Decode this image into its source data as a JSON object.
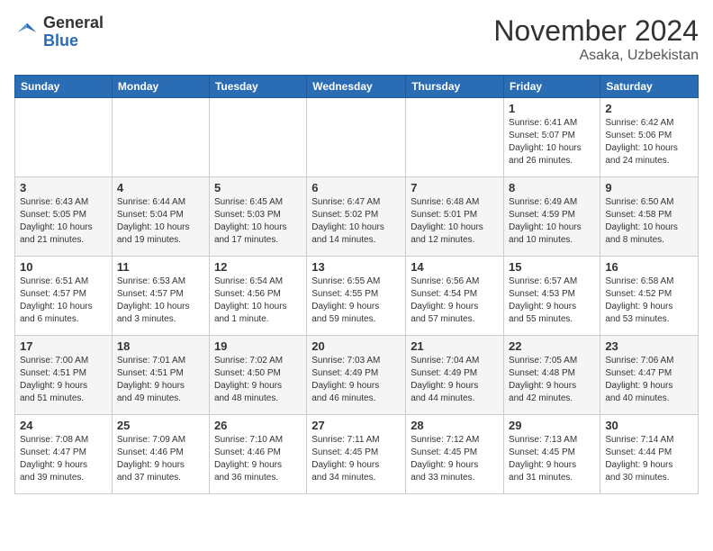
{
  "header": {
    "logo_general": "General",
    "logo_blue": "Blue",
    "month_title": "November 2024",
    "location": "Asaka, Uzbekistan"
  },
  "weekdays": [
    "Sunday",
    "Monday",
    "Tuesday",
    "Wednesday",
    "Thursday",
    "Friday",
    "Saturday"
  ],
  "weeks": [
    [
      {
        "day": "",
        "info": ""
      },
      {
        "day": "",
        "info": ""
      },
      {
        "day": "",
        "info": ""
      },
      {
        "day": "",
        "info": ""
      },
      {
        "day": "",
        "info": ""
      },
      {
        "day": "1",
        "info": "Sunrise: 6:41 AM\nSunset: 5:07 PM\nDaylight: 10 hours\nand 26 minutes."
      },
      {
        "day": "2",
        "info": "Sunrise: 6:42 AM\nSunset: 5:06 PM\nDaylight: 10 hours\nand 24 minutes."
      }
    ],
    [
      {
        "day": "3",
        "info": "Sunrise: 6:43 AM\nSunset: 5:05 PM\nDaylight: 10 hours\nand 21 minutes."
      },
      {
        "day": "4",
        "info": "Sunrise: 6:44 AM\nSunset: 5:04 PM\nDaylight: 10 hours\nand 19 minutes."
      },
      {
        "day": "5",
        "info": "Sunrise: 6:45 AM\nSunset: 5:03 PM\nDaylight: 10 hours\nand 17 minutes."
      },
      {
        "day": "6",
        "info": "Sunrise: 6:47 AM\nSunset: 5:02 PM\nDaylight: 10 hours\nand 14 minutes."
      },
      {
        "day": "7",
        "info": "Sunrise: 6:48 AM\nSunset: 5:01 PM\nDaylight: 10 hours\nand 12 minutes."
      },
      {
        "day": "8",
        "info": "Sunrise: 6:49 AM\nSunset: 4:59 PM\nDaylight: 10 hours\nand 10 minutes."
      },
      {
        "day": "9",
        "info": "Sunrise: 6:50 AM\nSunset: 4:58 PM\nDaylight: 10 hours\nand 8 minutes."
      }
    ],
    [
      {
        "day": "10",
        "info": "Sunrise: 6:51 AM\nSunset: 4:57 PM\nDaylight: 10 hours\nand 6 minutes."
      },
      {
        "day": "11",
        "info": "Sunrise: 6:53 AM\nSunset: 4:57 PM\nDaylight: 10 hours\nand 3 minutes."
      },
      {
        "day": "12",
        "info": "Sunrise: 6:54 AM\nSunset: 4:56 PM\nDaylight: 10 hours\nand 1 minute."
      },
      {
        "day": "13",
        "info": "Sunrise: 6:55 AM\nSunset: 4:55 PM\nDaylight: 9 hours\nand 59 minutes."
      },
      {
        "day": "14",
        "info": "Sunrise: 6:56 AM\nSunset: 4:54 PM\nDaylight: 9 hours\nand 57 minutes."
      },
      {
        "day": "15",
        "info": "Sunrise: 6:57 AM\nSunset: 4:53 PM\nDaylight: 9 hours\nand 55 minutes."
      },
      {
        "day": "16",
        "info": "Sunrise: 6:58 AM\nSunset: 4:52 PM\nDaylight: 9 hours\nand 53 minutes."
      }
    ],
    [
      {
        "day": "17",
        "info": "Sunrise: 7:00 AM\nSunset: 4:51 PM\nDaylight: 9 hours\nand 51 minutes."
      },
      {
        "day": "18",
        "info": "Sunrise: 7:01 AM\nSunset: 4:51 PM\nDaylight: 9 hours\nand 49 minutes."
      },
      {
        "day": "19",
        "info": "Sunrise: 7:02 AM\nSunset: 4:50 PM\nDaylight: 9 hours\nand 48 minutes."
      },
      {
        "day": "20",
        "info": "Sunrise: 7:03 AM\nSunset: 4:49 PM\nDaylight: 9 hours\nand 46 minutes."
      },
      {
        "day": "21",
        "info": "Sunrise: 7:04 AM\nSunset: 4:49 PM\nDaylight: 9 hours\nand 44 minutes."
      },
      {
        "day": "22",
        "info": "Sunrise: 7:05 AM\nSunset: 4:48 PM\nDaylight: 9 hours\nand 42 minutes."
      },
      {
        "day": "23",
        "info": "Sunrise: 7:06 AM\nSunset: 4:47 PM\nDaylight: 9 hours\nand 40 minutes."
      }
    ],
    [
      {
        "day": "24",
        "info": "Sunrise: 7:08 AM\nSunset: 4:47 PM\nDaylight: 9 hours\nand 39 minutes."
      },
      {
        "day": "25",
        "info": "Sunrise: 7:09 AM\nSunset: 4:46 PM\nDaylight: 9 hours\nand 37 minutes."
      },
      {
        "day": "26",
        "info": "Sunrise: 7:10 AM\nSunset: 4:46 PM\nDaylight: 9 hours\nand 36 minutes."
      },
      {
        "day": "27",
        "info": "Sunrise: 7:11 AM\nSunset: 4:45 PM\nDaylight: 9 hours\nand 34 minutes."
      },
      {
        "day": "28",
        "info": "Sunrise: 7:12 AM\nSunset: 4:45 PM\nDaylight: 9 hours\nand 33 minutes."
      },
      {
        "day": "29",
        "info": "Sunrise: 7:13 AM\nSunset: 4:45 PM\nDaylight: 9 hours\nand 31 minutes."
      },
      {
        "day": "30",
        "info": "Sunrise: 7:14 AM\nSunset: 4:44 PM\nDaylight: 9 hours\nand 30 minutes."
      }
    ]
  ]
}
